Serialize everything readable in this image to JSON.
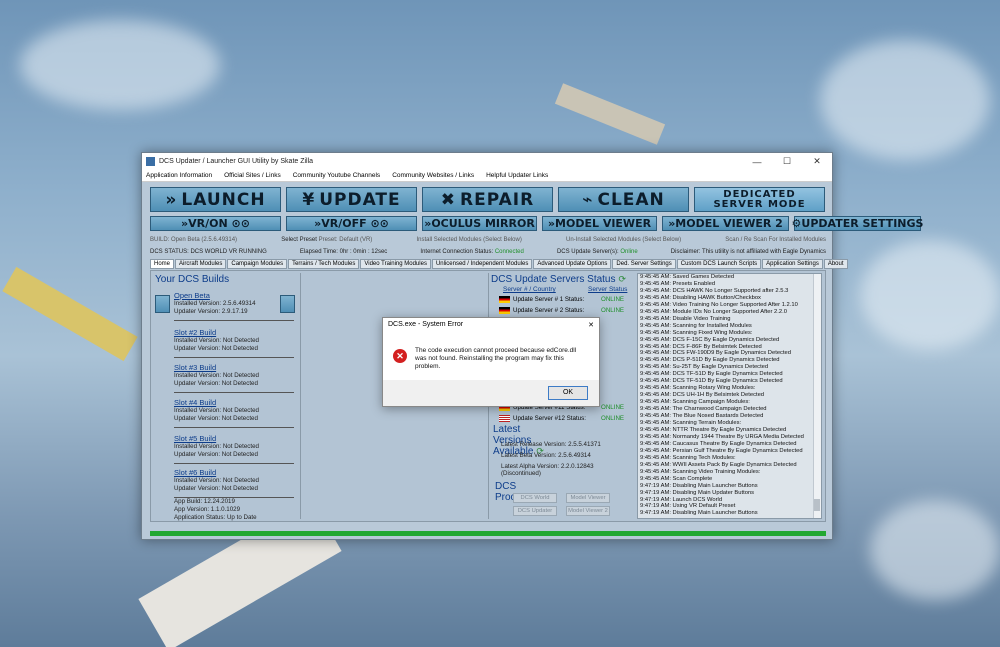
{
  "window": {
    "title": "DCS Updater / Launcher GUI Utility by Skate Zilla"
  },
  "menu": [
    "Application Information",
    "Official Sites / Links",
    "Community Youtube Channels",
    "Community Websites / Links",
    "Helpful Updater Links"
  ],
  "big_buttons": {
    "launch": "LAUNCH",
    "update": "UPDATE",
    "repair": "REPAIR",
    "clean": "CLEAN",
    "dedicated_1": "DEDICATED",
    "dedicated_2": "SERVER MODE"
  },
  "mid_buttons": [
    "VR/ON",
    "VR/OFF",
    "OCULUS MIRROR",
    "MODEL VIEWER",
    "MODEL VIEWER 2",
    "UPDATER SETTINGS"
  ],
  "row1": {
    "build": "BUILD: Open Beta (2.5.6.49314)",
    "select_preset": "Select Preset",
    "preset": "Preset: Default (VR)",
    "install": "Install Selected Modules (Select Below)",
    "uninstall": "Un-Install Selected Modules (Select Below)",
    "scan": "Scan / Re Scan For Installed Modules"
  },
  "row2": {
    "status": "DCS STATUS: DCS WORLD VR RUNNING",
    "elapsed": "Elapsed Time: 0hr : 0min : 12sec",
    "internet_label": "Internet Connection Status:",
    "internet_value": "Connected",
    "servers_label": "DCS Update Server(s):",
    "servers_value": "Online",
    "disclaimer": "Disclaimer: This utility is not affiliated with Eagle Dynamics"
  },
  "tabs": [
    "Home",
    "Aircraft Modules",
    "Campaign Modules",
    "Terrains / Tech Modules",
    "Video Training Modules",
    "Unlicensed / Independent Modules",
    "Advanced Update Options",
    "Ded. Server Settings",
    "Custom DCS Launch Scripts",
    "Application Settings",
    "About"
  ],
  "builds": {
    "heading": "Your DCS Builds",
    "slots": [
      {
        "name": "Open Beta",
        "installed": "Installed Version: 2.5.6.49314",
        "updater": "Updater Version: 2.9.17.19"
      },
      {
        "name": "Slot #2 Build",
        "installed": "Installed Version: Not Detected",
        "updater": "Updater Version: Not Detected"
      },
      {
        "name": "Slot #3 Build",
        "installed": "Installed Version: Not Detected",
        "updater": "Updater Version: Not Detected"
      },
      {
        "name": "Slot #4 Build",
        "installed": "Installed Version: Not Detected",
        "updater": "Updater Version: Not Detected"
      },
      {
        "name": "Slot #5 Build",
        "installed": "Installed Version: Not Detected",
        "updater": "Updater Version: Not Detected"
      },
      {
        "name": "Slot #6 Build",
        "installed": "Installed Version: Not Detected",
        "updater": "Updater Version: Not Detected"
      }
    ],
    "app_build": "App Build:  12.24.2019",
    "app_version": "App Version:  1.1.0.1029",
    "app_status": "Application Status: Up to Date"
  },
  "servers": {
    "heading": "DCS Update Servers Status",
    "col1": "Server # / Country",
    "col2": "Server Status",
    "rows": [
      {
        "label": "Update Server # 1 Status:",
        "status": "ONLINE"
      },
      {
        "label": "Update Server # 2 Status:",
        "status": "ONLINE"
      },
      {
        "label": "Update Server #11 Status:",
        "status": "ONLINE"
      },
      {
        "label": "Update Server #12 Status:",
        "status": "ONLINE"
      }
    ]
  },
  "versions": {
    "heading": "Latest Versions Available",
    "release": "Latest Release Version: 2.5.5.41371",
    "beta": "Latest Beta Version: 2.5.6.49314",
    "alpha": "Latest Alpha Version: 2.2.0.12843 (Discontinued)"
  },
  "processes": {
    "heading": "DCS Processes",
    "buttons": [
      "DCS World",
      "Model Viewer",
      "DCS Updater",
      "Model Viewer 2"
    ]
  },
  "log": [
    "9:45:45 AM:  Saved Games Detected",
    "9:45:45 AM:  Presets Enabled",
    "9:45:45 AM:  DCS HAWK No Longer Supported after 2.5.3",
    "9:45:45 AM:  Disabling HAWK Button/Checkbox",
    "9:45:45 AM:  Video Training No Longer Supported After 1.2.10",
    "9:45:45 AM:  Module IDs No Longer Supported After 2.2.0",
    "9:45:45 AM:  Disable Video Training",
    "9:45:45 AM:  Scanning for Installed Modules",
    "9:45:45 AM:  Scanning Fixed Wing Modules:",
    "9:45:45 AM:  DCS F-15C By Eagle Dynamics Detected",
    "9:45:45 AM:  DCS F-86F By Belsimtek Detected",
    "9:45:45 AM:  DCS FW-190D9 By Eagle Dynamics Detected",
    "9:45:45 AM:  DCS P-51D By Eagle Dynamics Detected",
    "9:45:45 AM:  Su-25T By Eagle Dynamics Detected",
    "9:45:45 AM:  DCS TF-51D By Eagle Dynamics Detected",
    "9:45:45 AM:  DCS TF-51D By Eagle Dynamics Detected",
    "9:45:45 AM:  Scanning Rotary Wing Modules:",
    "9:45:45 AM:  DCS UH-1H By Belsimtek Detected",
    "9:45:45 AM:  Scanning Campaign Modules:",
    "9:45:45 AM:  The Charnwood Campaign Detected",
    "9:45:45 AM:  The Blue Nosed Bastards Detected",
    "9:45:45 AM:  Scanning Terrain Modules:",
    "9:45:45 AM:  NTTR Theatre By Eagle Dynamics Detected",
    "9:45:45 AM:  Normandy 1944 Theatre By URGA Media Detected",
    "9:45:45 AM:  Caucasus Theatre By Eagle Dynamics Detected",
    "9:45:45 AM:  Persian Gulf Theatre By Eagle Dynamics Detected",
    "9:45:45 AM:  Scanning Tech Modules:",
    "9:45:45 AM:  WWII Assets Pack By Eagle Dynamics Detected",
    "9:45:45 AM:  Scanning Video Training Modules:",
    "9:45:45 AM:  Scan Complete",
    "9:47:19 AM:  Disabling Main Launcher Buttons",
    "9:47:19 AM:  Disabling Main Updater Buttons",
    "9:47:19 AM:  Launch DCS World",
    "9:47:19 AM:  Using VR Default Preset",
    "9:47:19 AM:  Disabling Main Launcher Buttons"
  ],
  "dialog": {
    "title": "DCS.exe - System Error",
    "close": "✕",
    "message": "The code execution cannot proceed because edCore.dll was not found. Reinstalling the program may fix this problem.",
    "ok": "OK"
  },
  "titlebar_controls": {
    "minimize": "—",
    "maximize": "☐",
    "close": "✕"
  }
}
